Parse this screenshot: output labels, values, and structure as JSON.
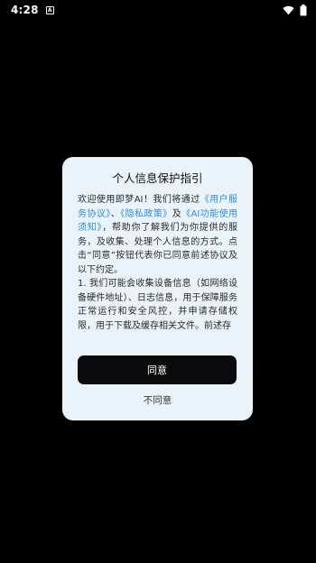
{
  "status_bar": {
    "time": "4:28",
    "notification_glyph": "A",
    "icons": [
      "wifi-icon",
      "battery-icon"
    ]
  },
  "dialog": {
    "title": "个人信息保护指引",
    "body": {
      "intro_prefix": "欢迎使用即梦AI！我们将通过",
      "link_user_agreement": "《用户服务协议》",
      "sep1": "、",
      "link_privacy_policy": "《隐私政策》",
      "and": "及",
      "link_ai_notice": "《AI功能使用须知》",
      "intro_suffix": "，帮助你了解我们为你提供的服务，及收集、处理个人信息的方式。点击“同意”按钮代表你已同意前述协议及以下约定。",
      "item1": "1. 我们可能会收集设备信息（如网络设备硬件地址）、日志信息，用于保障服务正常运行和安全风控，并申请存储权限，用于下载及缓存相关文件。前述存"
    },
    "agree_label": "同意",
    "disagree_label": "不同意"
  }
}
